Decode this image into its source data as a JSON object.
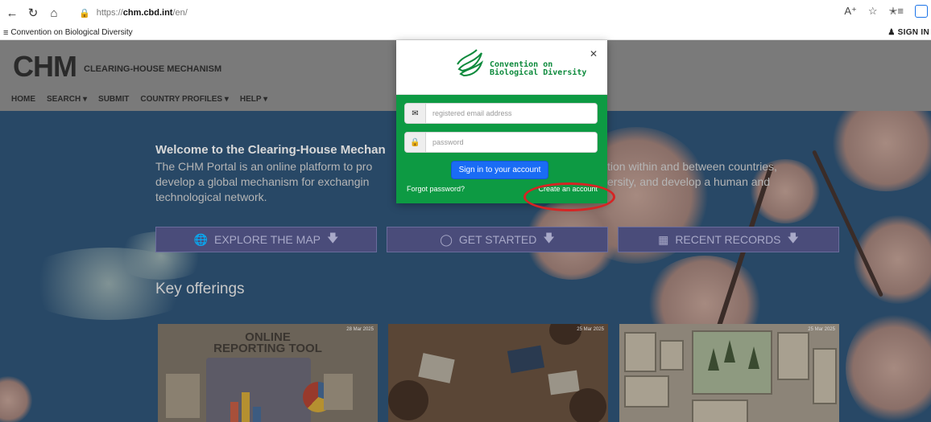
{
  "browser": {
    "url_scheme": "https://",
    "url_host": "chm.cbd.int",
    "url_path": "/en/"
  },
  "topbar": {
    "site_name": "Convention on Biological Diversity",
    "signin": "SIGN IN"
  },
  "header": {
    "logo": "CHM",
    "subtitle": "CLEARING-HOUSE MECHANISM",
    "nav": [
      "HOME",
      "SEARCH ▾",
      "SUBMIT",
      "COUNTRY PROFILES ▾",
      "HELP ▾"
    ]
  },
  "hero": {
    "welcome_title": "Welcome to the Clearing-House Mechan",
    "text_left": "The CHM Portal is an online platform to pro develop a global mechanism for exchangin technological network.",
    "text_right": "tion within and between countries, ersity, and develop a human and",
    "cta": [
      "EXPLORE THE MAP",
      "GET STARTED",
      "RECENT RECORDS"
    ],
    "key_offerings": "Key offerings"
  },
  "cards": [
    {
      "date": "28 Mar 2025",
      "title_line1": "ONLINE",
      "title_line2": "REPORTING TOOL"
    },
    {
      "date": "25 Mar 2025"
    },
    {
      "date": "25 Mar 2025"
    }
  ],
  "modal": {
    "org_line1": "Convention on",
    "org_line2": "Biological Diversity",
    "email_placeholder": "registered email address",
    "password_placeholder": "password",
    "signin_button": "Sign in to your account",
    "forgot": "Forgot password?",
    "create": "Create an account"
  },
  "colors": {
    "modal_green": "#0d9a43",
    "button_blue": "#1a6cf5",
    "highlight_red": "#d62424"
  }
}
